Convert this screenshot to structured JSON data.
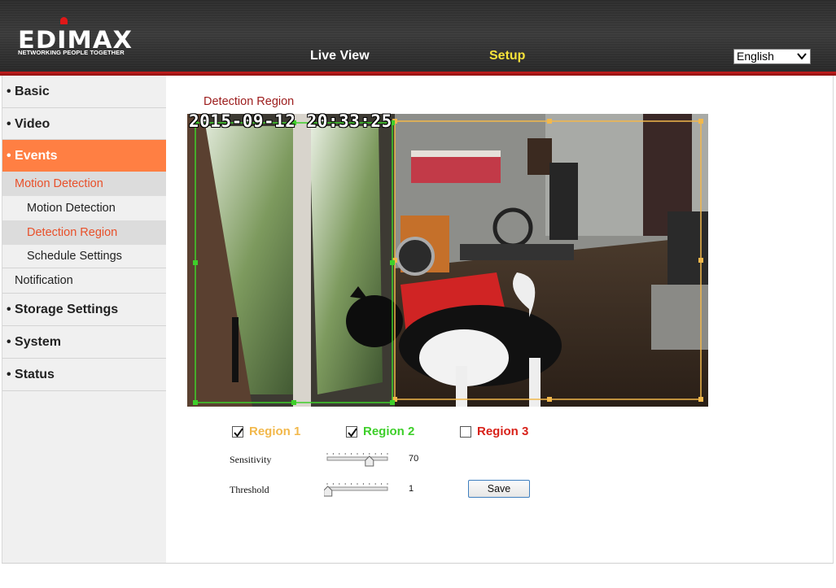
{
  "header": {
    "brand": "EDIMAX",
    "tagline": "NETWORKING PEOPLE TOGETHER",
    "nav": [
      {
        "label": "Live View",
        "active": false
      },
      {
        "label": "Setup",
        "active": true
      }
    ],
    "language": {
      "selected": "English"
    }
  },
  "sidebar": {
    "items": [
      {
        "label": "• Basic"
      },
      {
        "label": "• Video"
      },
      {
        "label": "• Events"
      },
      {
        "label": "Motion Detection"
      },
      {
        "label": "Motion Detection"
      },
      {
        "label": "Detection Region"
      },
      {
        "label": "Schedule Settings"
      },
      {
        "label": "Notification"
      },
      {
        "label": "• Storage Settings"
      },
      {
        "label": "• System"
      },
      {
        "label": "• Status"
      }
    ]
  },
  "main": {
    "section_title": "Detection Region",
    "timestamp": "2015-09-12 20:33:25",
    "regions": [
      {
        "label": "Region 1",
        "checked": true,
        "color": "#f2b84b"
      },
      {
        "label": "Region 2",
        "checked": true,
        "color": "#3ecf2a"
      },
      {
        "label": "Region 3",
        "checked": false,
        "color": "#d8221a"
      }
    ],
    "sensitivity": {
      "label": "Sensitivity",
      "value": 70,
      "max": 100
    },
    "threshold": {
      "label": "Threshold",
      "value": 1,
      "max": 100
    },
    "save_label": "Save"
  },
  "colors": {
    "accent": "#ff7f43",
    "active_text": "#e8502a",
    "title": "#9c1c1c",
    "setup_nav": "#f6e23a",
    "header_red": "#c81e1e"
  },
  "icons": {
    "checkbox": "check-icon",
    "language_dropdown": "chevron-down-icon"
  }
}
